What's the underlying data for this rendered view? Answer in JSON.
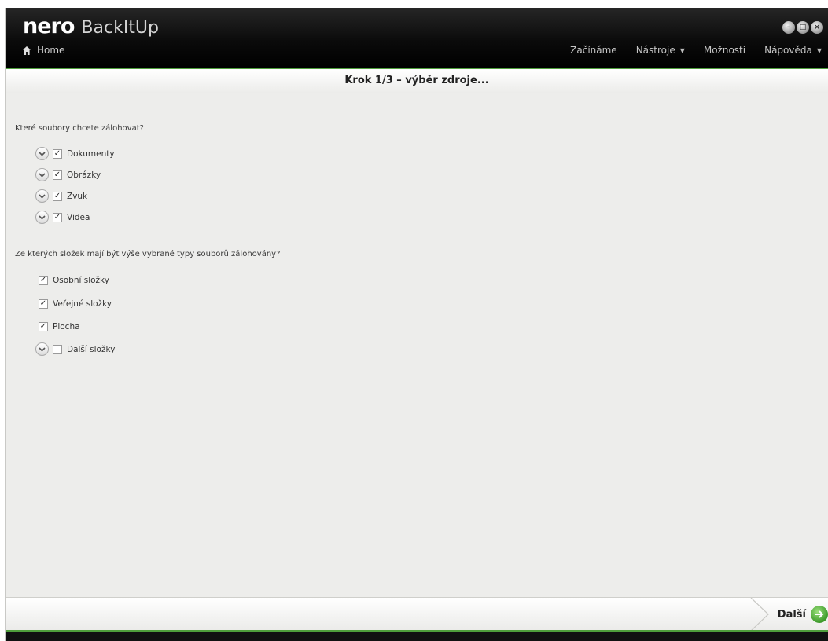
{
  "app": {
    "brand": "nero",
    "product": "BackItUp",
    "home_label": "Home"
  },
  "menu": {
    "items": [
      {
        "label": "Začínáme",
        "has_caret": false
      },
      {
        "label": "Nástroje",
        "has_caret": true
      },
      {
        "label": "Možnosti",
        "has_caret": false
      },
      {
        "label": "Nápověda",
        "has_caret": true
      }
    ]
  },
  "window_controls": {
    "minimize": "–",
    "maximize": "□",
    "close": "×"
  },
  "step": {
    "title": "Krok 1/3 – výběr zdroje..."
  },
  "file_types": {
    "question": "Které soubory chcete zálohovat?",
    "items": [
      {
        "label": "Dokumenty",
        "checked": true
      },
      {
        "label": "Obrázky",
        "checked": true
      },
      {
        "label": "Zvuk",
        "checked": true
      },
      {
        "label": "Videa",
        "checked": true
      }
    ]
  },
  "folders": {
    "question": "Ze kterých složek mají být výše vybrané typy souborů zálohovány?",
    "items": [
      {
        "label": "Osobní složky",
        "checked": true
      },
      {
        "label": "Veřejné složky",
        "checked": true
      },
      {
        "label": "Plocha",
        "checked": true
      },
      {
        "label": "Další složky",
        "checked": false
      }
    ]
  },
  "footer": {
    "next_label": "Další"
  },
  "colors": {
    "accent_green": "#4f9e3c",
    "title_bar": "#000000",
    "background": "#ededeb"
  }
}
